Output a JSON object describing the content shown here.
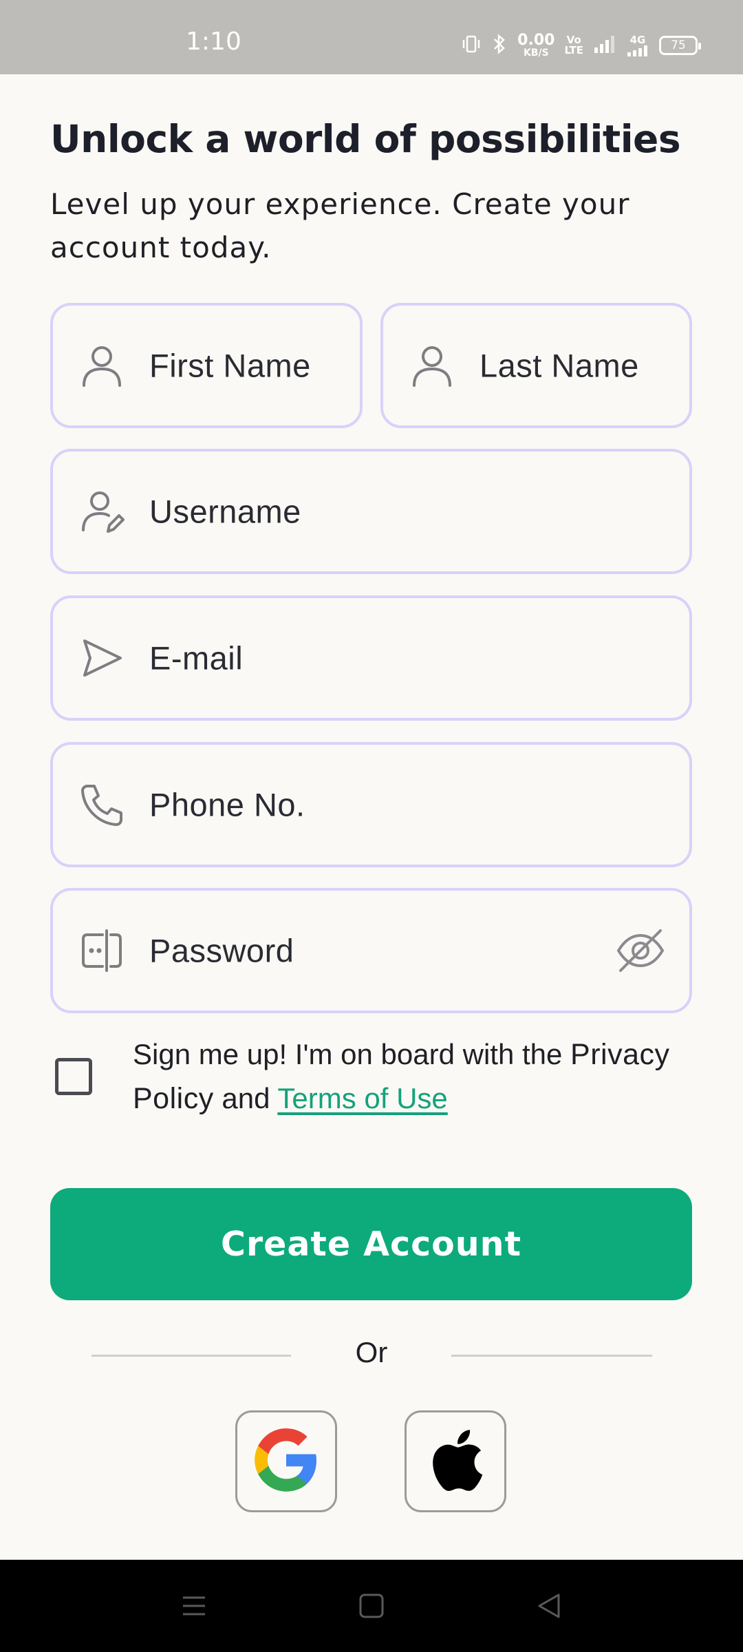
{
  "status_bar": {
    "time": "1:10",
    "net_speed_value": "0.00",
    "net_speed_unit": "KB/S",
    "volte_top": "Vo",
    "volte_bottom": "LTE",
    "network_type": "4G",
    "battery": "75"
  },
  "header": {
    "title": "Unlock a world of possibilities",
    "subtitle": "Level up your experience. Create your account today."
  },
  "form": {
    "first_name_placeholder": "First Name",
    "last_name_placeholder": "Last Name",
    "username_placeholder": "Username",
    "email_placeholder": "E-mail",
    "phone_placeholder": "Phone No.",
    "password_placeholder": "Password"
  },
  "agreement": {
    "prefix": "Sign me up! I'm on board with the",
    "privacy": "Privacy Policy",
    "and": "and",
    "terms": "Terms of Use",
    "checked": false
  },
  "actions": {
    "create_account": "Create Account",
    "or": "Or"
  },
  "social": {
    "google_icon": "google-icon",
    "apple_icon": "apple-icon"
  },
  "colors": {
    "accent": "#0DAA7C",
    "field_border": "#D8D2FA",
    "link": "#14A27A",
    "background": "#FAF9F5"
  }
}
